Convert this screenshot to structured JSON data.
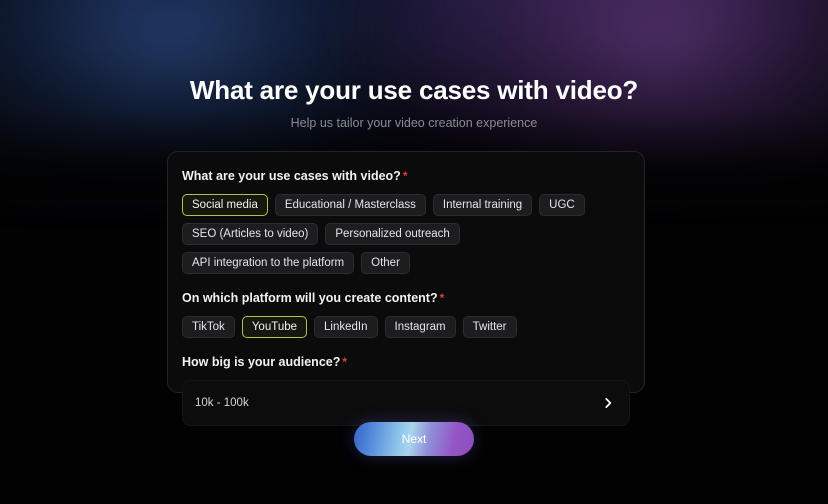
{
  "header": {
    "title": "What are your use cases with video?",
    "subtitle": "Help us tailor your video creation experience"
  },
  "form": {
    "required_marker": "*",
    "use_cases": {
      "label": "What are your use cases with video?",
      "options": [
        "Social media",
        "Educational / Masterclass",
        "Internal training",
        "UGC",
        "SEO (Articles to video)",
        "Personalized outreach",
        "API integration to the platform",
        "Other"
      ],
      "selected": "Social media"
    },
    "platform": {
      "label": "On which platform will you create content?",
      "options": [
        "TikTok",
        "YouTube",
        "LinkedIn",
        "Instagram",
        "Twitter"
      ],
      "selected": "YouTube"
    },
    "audience": {
      "label": "How big is your audience?",
      "value": "10k - 100k",
      "chevron_icon": "chevron-right-icon"
    }
  },
  "footer": {
    "next_label": "Next"
  },
  "colors": {
    "selected_border": "#b4c24b",
    "required_asterisk": "#df3f37",
    "chip_bg": "#1d1d1f",
    "card_bg": "#0b0b0c",
    "page_bg": "#020203",
    "button_gradient_start": "#3a63c4",
    "button_gradient_mid": "#a9d4ee",
    "button_gradient_end": "#8d4fbd",
    "glow_blue": "#2e4e8c",
    "glow_purple": "#683e8c"
  }
}
